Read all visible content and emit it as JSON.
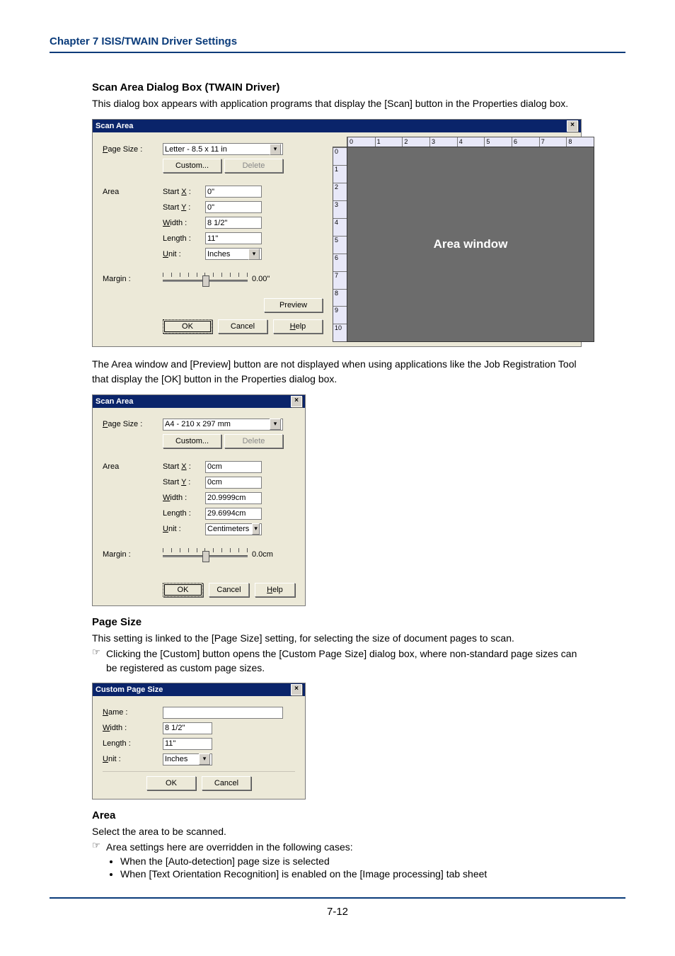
{
  "chapter": "Chapter 7   ISIS/TWAIN Driver Settings",
  "pageNumber": "7-12",
  "sec1": {
    "title": "Scan Area Dialog Box (TWAIN Driver)",
    "desc": "This dialog box appears with application programs that display the [Scan] button in the Properties dialog box."
  },
  "dlg1": {
    "title": "Scan Area",
    "pageSizeLabel": "Page Size :",
    "pageSizeLbl_u": "P",
    "pageSizeValue": "Letter - 8.5 x 11 in",
    "customBtn": "Custom...",
    "deleteBtn": "Delete",
    "areaLabel": "Area",
    "startX_u": "X",
    "startXLabel": "Start ",
    "startXSuffix": " :",
    "startXVal": "0\"",
    "startY_u": "Y",
    "startYLabel": "Start ",
    "startYSuffix": " :",
    "startYVal": "0\"",
    "width_u": "W",
    "widthLabel": "idth :",
    "widthVal": "8 1/2\"",
    "lengthLabel": "Length :",
    "lengthVal": "11\"",
    "unit_u": "U",
    "unitLabel": "nit :",
    "unitVal": "Inches",
    "marginLabel": "Margin :",
    "marginVal": "0.00\"",
    "previewBtn": "Preview",
    "okBtn": "OK",
    "cancelBtn": "Cancel",
    "help_u": "H",
    "helpBtn": "elp",
    "areaWindowLabel": "Area window",
    "rulerH": [
      "0",
      "1",
      "2",
      "3",
      "4",
      "5",
      "6",
      "7",
      "8"
    ],
    "rulerV": [
      "0",
      "1",
      "2",
      "3",
      "4",
      "5",
      "6",
      "7",
      "8",
      "9",
      "10"
    ]
  },
  "midText": "The Area window and [Preview] button are not displayed when using applications like the Job Registration Tool that display the [OK] button in the Properties dialog box.",
  "dlg2": {
    "title": "Scan Area",
    "pageSizeValue": "A4 - 210 x 297 mm",
    "startXVal": "0cm",
    "startYVal": "0cm",
    "widthVal": "20.9999cm",
    "lengthVal": "29.6994cm",
    "unitVal": "Centimeters",
    "marginVal": "0.0cm"
  },
  "sec2": {
    "title": "Page Size",
    "desc": "This setting is linked to the [Page Size] setting, for selecting the size of document pages to scan.",
    "note": "Clicking the [Custom] button opens the [Custom Page Size] dialog box, where non-standard page sizes can be registered as custom page sizes."
  },
  "dlg3": {
    "title": "Custom Page Size",
    "name_u": "N",
    "nameLabel": "ame :",
    "nameVal": "",
    "widthVal": "8 1/2\"",
    "lengthVal": "11\"",
    "unitVal": "Inches",
    "okBtn": "OK",
    "cancelBtn": "Cancel"
  },
  "sec3": {
    "title": "Area",
    "desc": "Select the area to be scanned.",
    "note": "Area settings here are overridden in the following cases:",
    "bullets": [
      "When the [Auto-detection] page size is selected",
      "When [Text Orientation Recognition] is enabled on the [Image processing] tab sheet"
    ]
  },
  "noteSymbol": "☞"
}
